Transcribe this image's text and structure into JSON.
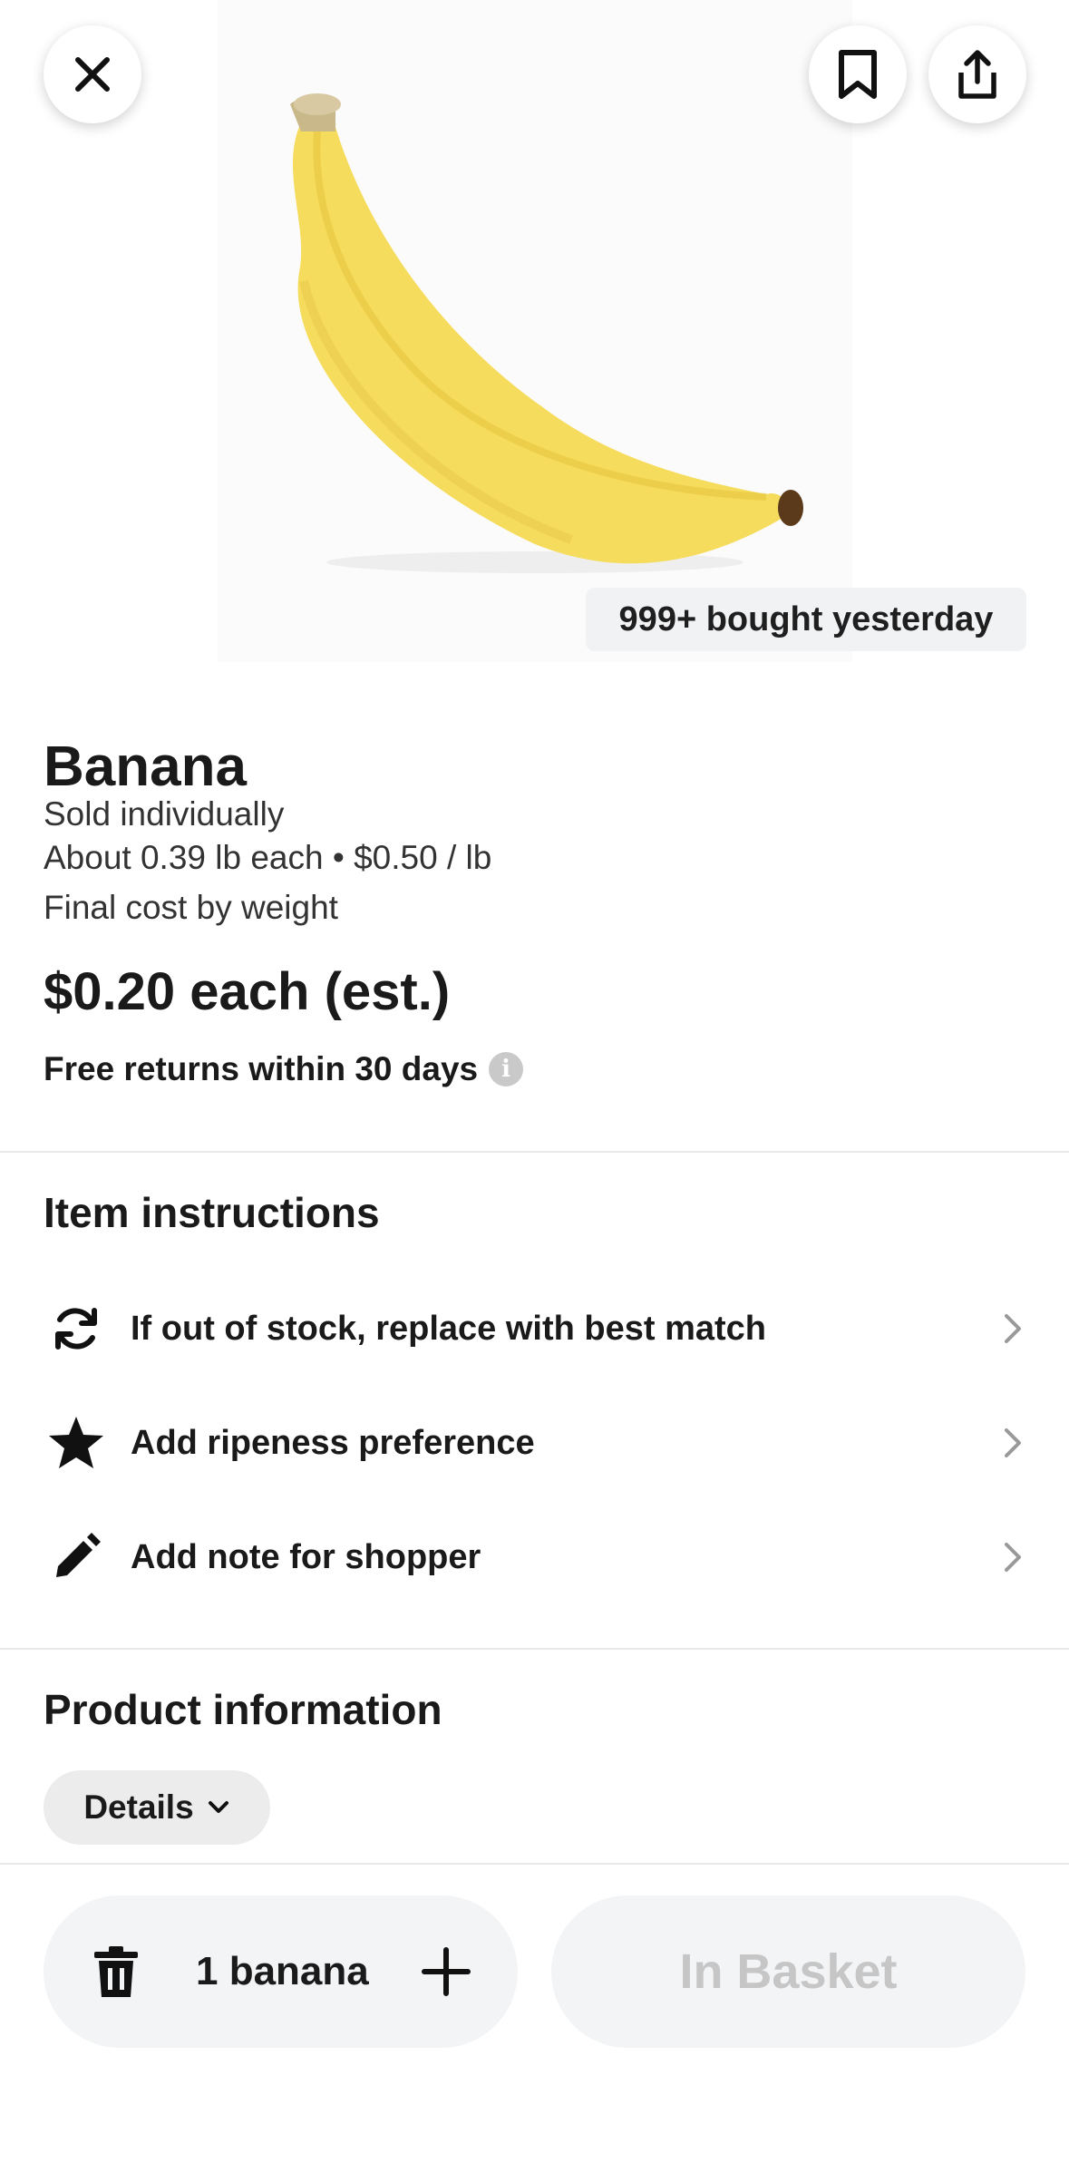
{
  "hero": {
    "badge": "999+ bought yesterday",
    "image_icon": "banana-image"
  },
  "top_actions": {
    "close_icon": "close-icon",
    "bookmark_icon": "bookmark-icon",
    "share_icon": "share-icon"
  },
  "product": {
    "name": "Banana",
    "sold": "Sold individually",
    "weight_price": "About 0.39 lb each • $0.50 / lb",
    "final_cost": "Final cost by weight",
    "price": "$0.20 each (est.)",
    "returns": "Free returns within 30 days",
    "returns_info_icon": "info-icon"
  },
  "instructions": {
    "title": "Item instructions",
    "items": [
      {
        "label": "If out of stock, replace with best match",
        "icon": "replace-icon"
      },
      {
        "label": "Add ripeness preference",
        "icon": "star-icon"
      },
      {
        "label": "Add note for shopper",
        "icon": "pencil-icon"
      }
    ]
  },
  "product_info": {
    "title": "Product information",
    "details_label": "Details"
  },
  "cart": {
    "quantity_label": "1 banana",
    "in_basket_label": "In Basket",
    "colors": {
      "stepper_bg": "#f3f4f6",
      "disabled_text": "#c6c6c6"
    }
  }
}
